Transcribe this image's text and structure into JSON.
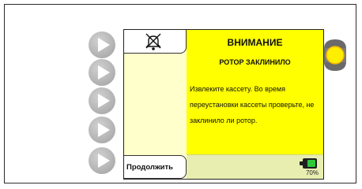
{
  "dialog": {
    "title": "ВНИМАНИЕ",
    "subtitle": "РОТОР ЗАКЛИНИЛО",
    "body": "Извлеките кассету.  Во время переустановки кассеты проверьте, не заклинило ли ротор."
  },
  "actions": {
    "continue_label": "Продолжить"
  },
  "status": {
    "battery_percent": "70%",
    "battery_level": 0.7
  },
  "icons": {
    "alarm_silenced": "bell-crossed-icon",
    "softkey": "play-triangle-icon",
    "alarm_indicator": "alarm-light-icon"
  },
  "colors": {
    "message_bg": "#ffff00",
    "side_bg": "#ffffcc",
    "status_bg": "#e8eeb0",
    "battery_fill": "#2fc83a",
    "alarm_light": "#ffee00"
  }
}
